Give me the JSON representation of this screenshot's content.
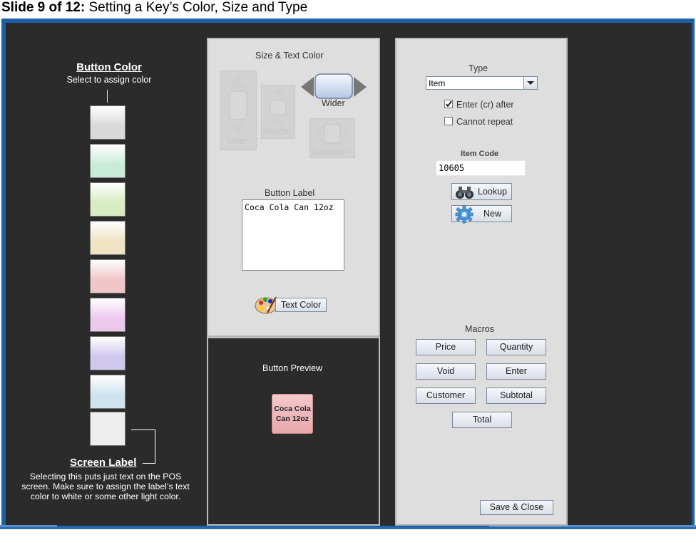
{
  "slide": {
    "number": "Slide 9 of 12:",
    "title": "Setting a Key’s Color, Size and Type"
  },
  "button_color": {
    "title": "Button Color",
    "subtitle": "Select to assign color",
    "swatches": [
      {
        "name": "gray",
        "color": "#d9d9d9"
      },
      {
        "name": "mint",
        "color": "#c9ecd9"
      },
      {
        "name": "lime",
        "color": "#d7ecc2"
      },
      {
        "name": "tan",
        "color": "#efe3c4"
      },
      {
        "name": "pink",
        "color": "#f0c6c8"
      },
      {
        "name": "lilac",
        "color": "#ecc9ec"
      },
      {
        "name": "lavender",
        "color": "#d1c8ee"
      },
      {
        "name": "sky",
        "color": "#cfe3ee"
      },
      {
        "name": "screen-label",
        "color": "#eeeeee"
      }
    ]
  },
  "screen_label": {
    "title": "Screen Label",
    "description": "Selecting this puts just text on the POS screen. Make sure to assign the label’s text color to white or some other light color."
  },
  "size_text": {
    "title": "Size & Text Color",
    "taller": "Taller",
    "shorter": "Shorter",
    "wider": "Wider",
    "narrower": "Narrower",
    "button_label_title": "Button Label",
    "button_label_value": "Coca Cola Can 12oz",
    "text_color_button": "Text Color"
  },
  "preview": {
    "title": "Button Preview",
    "line1": "Coca Cola",
    "line2": "Can 12oz",
    "color": "#f0c0c3"
  },
  "type_panel": {
    "title": "Type",
    "type_value": "Item",
    "enter_after_label": "Enter (cr) after",
    "enter_after_checked": true,
    "cannot_repeat_label": "Cannot repeat",
    "cannot_repeat_checked": false,
    "item_code_label": "Item Code",
    "item_code_value": "10605",
    "lookup_button": "Lookup",
    "new_button": "New"
  },
  "macros": {
    "title": "Macros",
    "buttons": [
      "Price",
      "Quantity",
      "Void",
      "Enter",
      "Customer",
      "Subtotal",
      "Total"
    ]
  },
  "save_close": "Save & Close"
}
